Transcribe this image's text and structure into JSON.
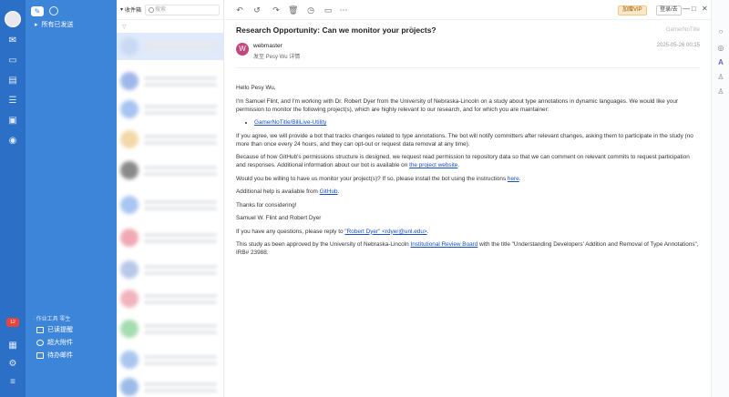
{
  "folders": {
    "sent_all": "所有已发送",
    "tools_header": "· 作业工具 零生",
    "tools": [
      "已读提醒",
      "超大附件",
      "待办邮件"
    ]
  },
  "rail": {
    "badge": "12"
  },
  "list": {
    "inbox_label": "收件箱",
    "search_placeholder": "搜索"
  },
  "toolbar": {
    "vip_label": "加赠VIP",
    "login_label": "登录/去",
    "win_min": "—",
    "win_max": "□",
    "win_close": "✕"
  },
  "message": {
    "subject": "Research Opportunity: Can we monitor your projects?",
    "tag": "GamerNoTitle",
    "sender_initial": "W",
    "sender_name": "webmaster",
    "sender_to": "发至 Pesy Wu   详情",
    "date": "2025-05-26 00:15",
    "greeting": "Hello Pesy Wu,",
    "intro": "I'm Samuel Flint, and I'm working with Dr. Robert Dyer from the University of Nebraska-Lincoln on a study about type annotations in dynamic languages. We would like your permission to monitor the following project(s), which are highly relevant to our research, and for which you are maintainer:",
    "project": "GamerNoTitle/BiliLive-Utility",
    "p_agree": "If you agree, we will provide a bot that tracks changes related to type annotations. The bot will notify committers after relevant changes, asking them to participate in the study (no more than once every 24 hours, and they can opt-out or request data removal at any time).",
    "p_perm_pre": "Because of how GitHub's permissions structure is designed, we request read permission to repository data so that we can comment on relevant commits to request participation and responses. Additional information about our bot is available on ",
    "p_perm_link": "the project website",
    "p_perm_post": ".",
    "p_install_pre": "Would you be willing to have us monitor your project(s)? If so, please install the bot using the instructions ",
    "p_install_link": "here",
    "p_install_post": ".",
    "p_help_pre": "Additional help is available from ",
    "p_help_link": "GitHub",
    "p_help_post": ".",
    "p_thanks": "Thanks for considering!",
    "p_sign": "Samuel W. Flint and Robert Dyer",
    "p_reply_pre": "If you have any questions, please reply to ",
    "p_reply_link": "\"Robert Dyer\" <rdyer@unl.edu>",
    "p_reply_post": ".",
    "p_irb_pre": "This study as been approved by the University of Nebraska-Lincoln ",
    "p_irb_link": "Institutional Review Board",
    "p_irb_post": " with the title \"Understanding Developers' Addition and Removal of Type Annotations\", IRB# 23988."
  }
}
